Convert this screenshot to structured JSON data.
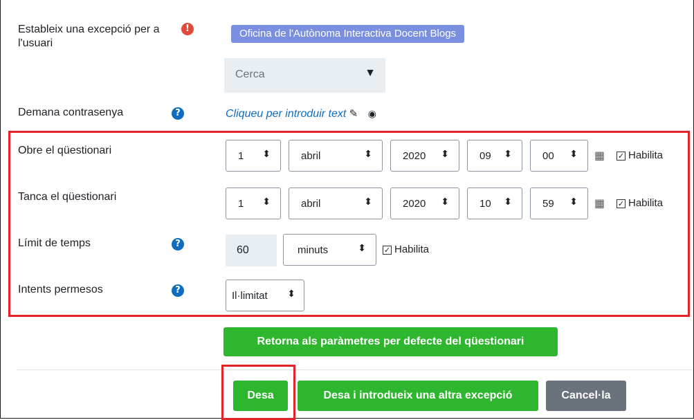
{
  "exception": {
    "label": "Estableix una excepció per a l'usuari",
    "required_icon": "!",
    "user_badge": "Oficina de l'Autònoma Interactiva Docent Blogs",
    "search_placeholder": "Cerca",
    "search_arrow": "▼"
  },
  "password": {
    "label": "Demana contrasenya",
    "help_icon": "?",
    "link_text": "Cliqueu per introduir text",
    "edit_icon": "✎",
    "eye_icon": "◉"
  },
  "open_quiz": {
    "label": "Obre el qüestionari",
    "day": "1",
    "month": "abril",
    "year": "2020",
    "hour": "09",
    "minute": "00",
    "enable_label": "Habilita",
    "enabled": true
  },
  "close_quiz": {
    "label": "Tanca el qüestionari",
    "day": "1",
    "month": "abril",
    "year": "2020",
    "hour": "10",
    "minute": "59",
    "enable_label": "Habilita",
    "enabled": true
  },
  "time_limit": {
    "label": "Límit de temps",
    "help_icon": "?",
    "value": "60",
    "unit": "minuts",
    "enable_label": "Habilita",
    "enabled": true
  },
  "attempts": {
    "label": "Intents permesos",
    "help_icon": "?",
    "value": "Il·limitat"
  },
  "buttons": {
    "reset": "Retorna als paràmetres per defecte del qüestionari",
    "save": "Desa",
    "save_another": "Desa i introdueix una altra excepció",
    "cancel": "Cancel·la"
  },
  "glyphs": {
    "updown": "⬍",
    "calendar": "▦",
    "check": "✓"
  },
  "colors": {
    "accent_blue": "#0f6cbf",
    "badge": "#7b8fe0",
    "green_button": "#2fb62f",
    "grey_button": "#6a737b",
    "highlight_red": "#e0242a"
  }
}
